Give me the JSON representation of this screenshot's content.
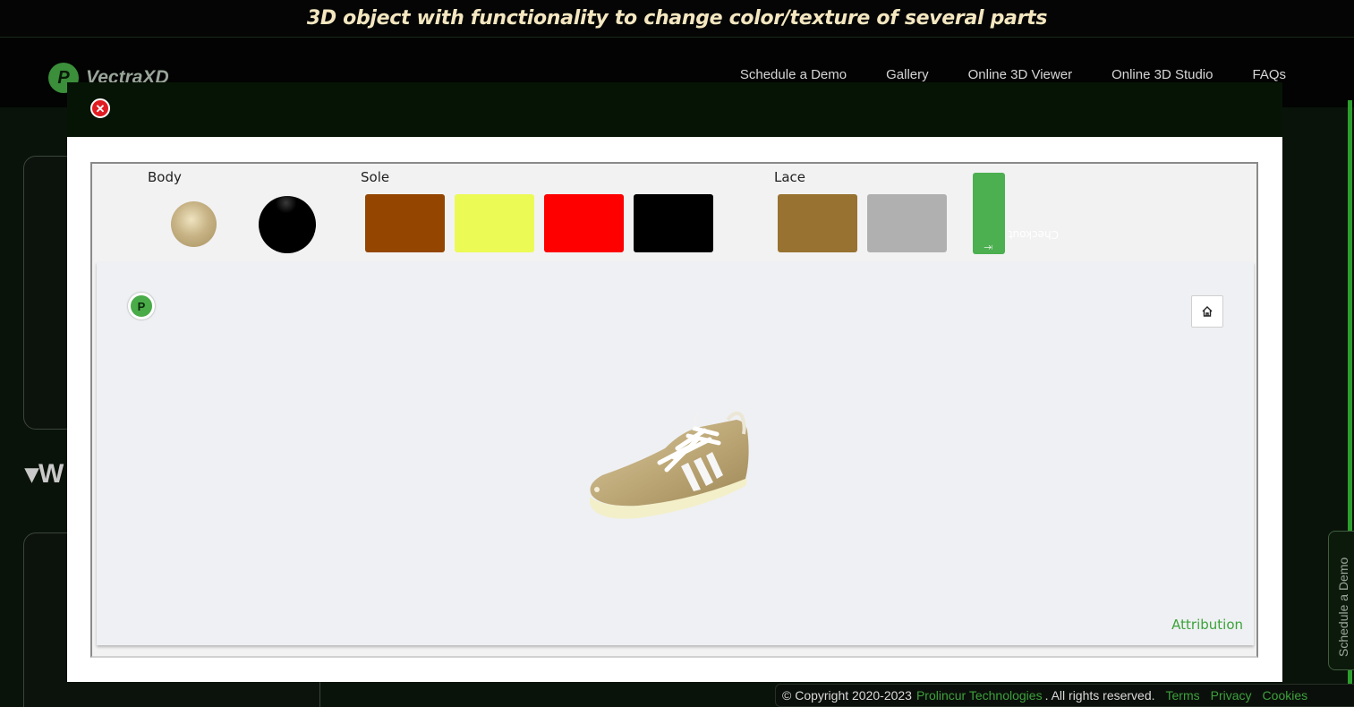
{
  "banner": {
    "caption": "3D object with functionality to change color/texture of several parts"
  },
  "site": {
    "logo_text": "VectraXD",
    "nav": [
      "Schedule a Demo",
      "Gallery",
      "Online 3D Viewer",
      "Online 3D Studio",
      "FAQs"
    ],
    "side_tab": "Schedule a Demo",
    "footer": {
      "copyright": "© Copyright 2020-2023",
      "company": "Prolincur Technologies",
      "rights": ". All rights reserved.",
      "links": [
        "Terms",
        "Privacy",
        "Cookies"
      ]
    }
  },
  "configurator": {
    "parts": [
      {
        "label": "Body",
        "options": [
          {
            "color": "#c8b585",
            "kind": "sphere"
          },
          {
            "color": "#000000",
            "kind": "sphere"
          }
        ]
      },
      {
        "label": "Sole",
        "options": [
          {
            "color": "#944600"
          },
          {
            "color": "#ecfa55"
          },
          {
            "color": "#ff0000"
          },
          {
            "color": "#000000"
          }
        ]
      },
      {
        "label": "Lace",
        "options": [
          {
            "color": "#977230"
          },
          {
            "color": "#b0b0b0"
          }
        ]
      }
    ],
    "checkout_label": "Checkout",
    "attribution": "Attribution"
  }
}
